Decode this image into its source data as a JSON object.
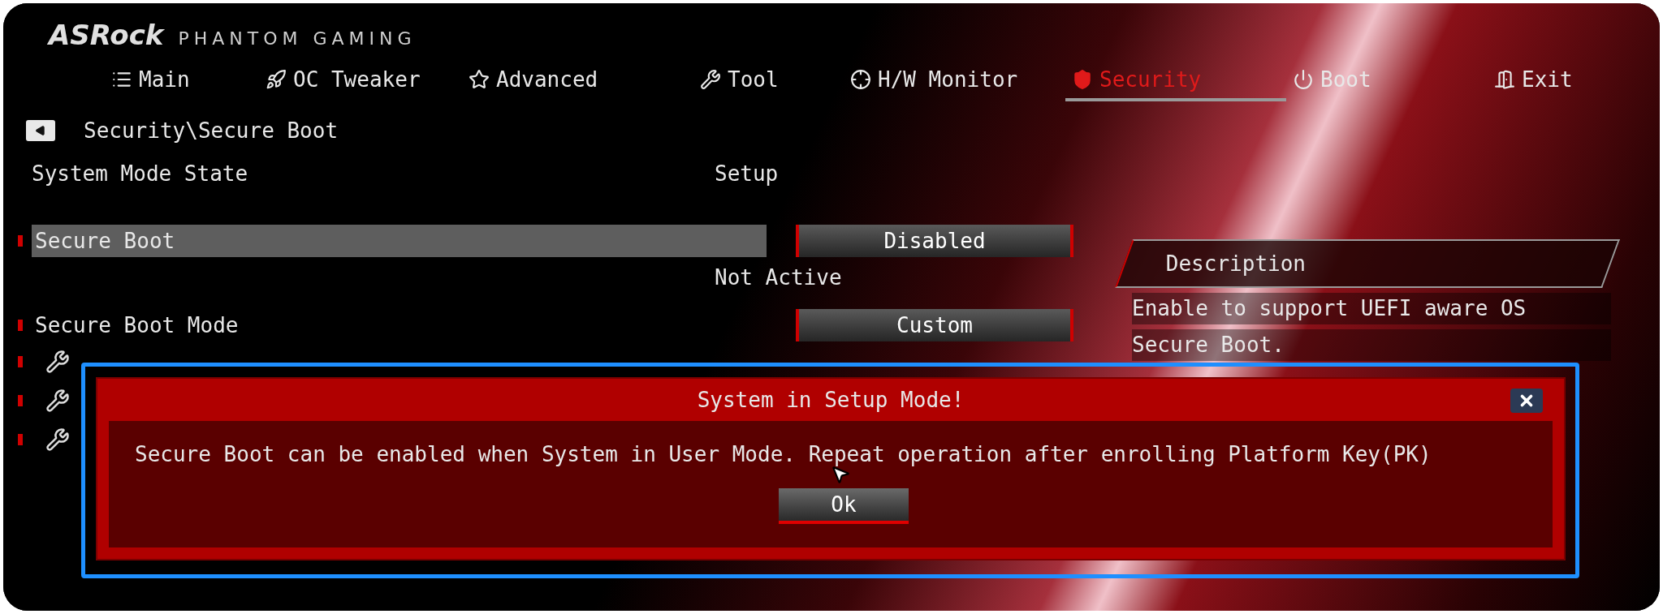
{
  "logo": {
    "brand": "ASRock",
    "product": "PHANTOM GAMING"
  },
  "tabs": [
    {
      "label": "Main",
      "selected": false
    },
    {
      "label": "OC Tweaker",
      "selected": false
    },
    {
      "label": "Advanced",
      "selected": false
    },
    {
      "label": "Tool",
      "selected": false
    },
    {
      "label": "H/W Monitor",
      "selected": false
    },
    {
      "label": "Security",
      "selected": true
    },
    {
      "label": "Boot",
      "selected": false
    },
    {
      "label": "Exit",
      "selected": false
    }
  ],
  "breadcrumb": "Security\\Secure Boot",
  "items": [
    {
      "kind": "info",
      "label": "System Mode State",
      "value": "Setup"
    },
    {
      "kind": "option",
      "label": "Secure Boot",
      "value": "Disabled",
      "selected": true,
      "status": "Not Active"
    },
    {
      "kind": "option",
      "label": "Secure Boot Mode",
      "value": "Custom",
      "selected": false
    },
    {
      "kind": "tool"
    },
    {
      "kind": "tool"
    },
    {
      "kind": "tool"
    }
  ],
  "description": {
    "title": "Description",
    "lines": [
      "Enable to support UEFI aware OS",
      "Secure Boot."
    ]
  },
  "dialog": {
    "title": "System in Setup Mode!",
    "message": "Secure Boot can be enabled when System in User Mode. Repeat operation after enrolling Platform Key(PK)",
    "button": "Ok"
  }
}
